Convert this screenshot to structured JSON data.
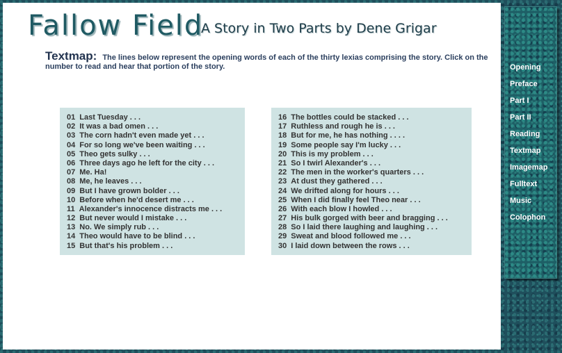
{
  "header": {
    "title": "Fallow Field",
    "subtitle": "A Story in Two Parts by Dene Grigar"
  },
  "intro": {
    "heading": "Textmap:",
    "text": "The lines below represent the opening words of each of the thirty lexias comprising the story. Click on the number to read and hear that portion of the story."
  },
  "lexias": [
    {
      "num": "01",
      "text": "Last Tuesday . . ."
    },
    {
      "num": "02",
      "text": "It was a bad omen . . ."
    },
    {
      "num": "03",
      "text": "The corn hadn't even made yet . . ."
    },
    {
      "num": "04",
      "text": "For so long we've been waiting . . ."
    },
    {
      "num": "05",
      "text": "Theo gets sulky . . ."
    },
    {
      "num": "06",
      "text": "Three days ago he left for the city . . ."
    },
    {
      "num": "07",
      "text": "Me.  Ha!"
    },
    {
      "num": "08",
      "text": "Me, he leaves . . ."
    },
    {
      "num": "09",
      "text": "But I have grown bolder . . ."
    },
    {
      "num": "10",
      "text": "Before when he'd desert me . . ."
    },
    {
      "num": "11",
      "text": "Alexander's innocence distracts me . . ."
    },
    {
      "num": "12",
      "text": "But never would I mistake . . ."
    },
    {
      "num": "13",
      "text": "No. We simply rub . . ."
    },
    {
      "num": "14",
      "text": "Theo would have to be blind . . ."
    },
    {
      "num": "15",
      "text": "But that's his problem . . ."
    },
    {
      "num": "16",
      "text": "The bottles could be stacked . . ."
    },
    {
      "num": "17",
      "text": "Ruthless and rough he is . . ."
    },
    {
      "num": "18",
      "text": "But for me, he has nothing . . . ."
    },
    {
      "num": "19",
      "text": "Some people say I'm lucky . . ."
    },
    {
      "num": "20",
      "text": "This is my problem . . ."
    },
    {
      "num": "21",
      "text": "So I twirl Alexander's . . ."
    },
    {
      "num": "22",
      "text": "The men in the worker's quarters . . ."
    },
    {
      "num": "23",
      "text": "At dust they gathered . . ."
    },
    {
      "num": "24",
      "text": "We drifted along for hours . . ."
    },
    {
      "num": "25",
      "text": "When I did finally feel Theo near . . ."
    },
    {
      "num": "26",
      "text": "With each blow I howled . . ."
    },
    {
      "num": "27",
      "text": "His bulk gorged with beer and bragging . . ."
    },
    {
      "num": "28",
      "text": "So I laid there laughing and laughing . . ."
    },
    {
      "num": "29",
      "text": "Sweat and blood followed me . . ."
    },
    {
      "num": "30",
      "text": "I laid down between the rows . . ."
    }
  ],
  "nav": {
    "items": [
      "Opening",
      "Preface",
      "Part I",
      "Part II",
      "Reading",
      "Textmap",
      "Imagemap",
      "Fulltext",
      "Music",
      "Colophon"
    ]
  }
}
